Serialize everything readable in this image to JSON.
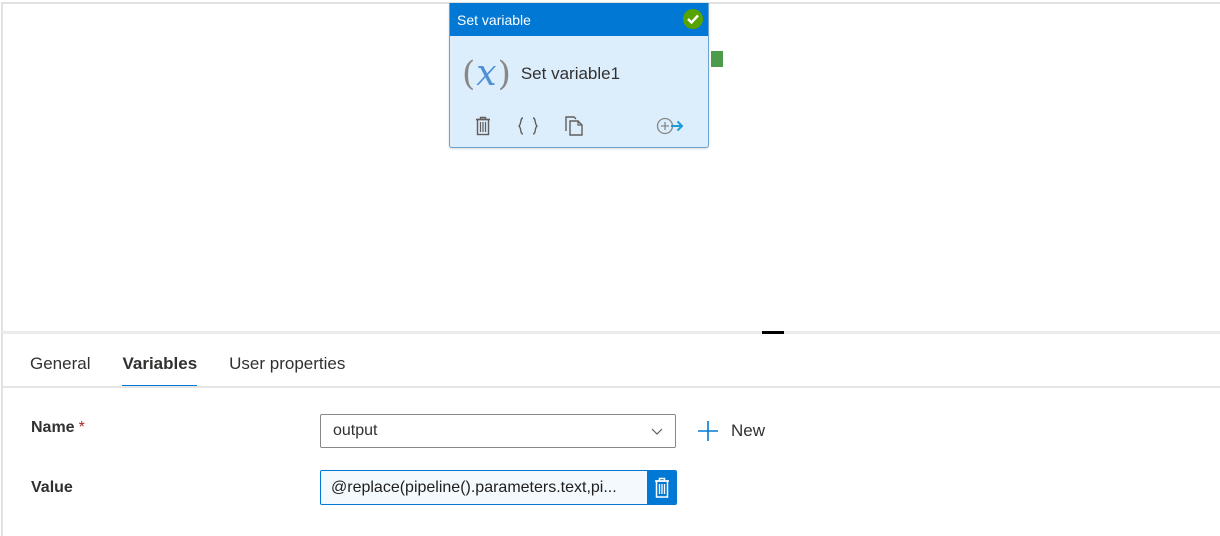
{
  "canvas": {
    "activity": {
      "type_label": "Set variable",
      "name": "Set variable1",
      "status": "succeeded",
      "icon": "variable-x-icon",
      "actions": [
        {
          "name": "delete",
          "icon": "trash-icon"
        },
        {
          "name": "code",
          "icon": "braces-icon"
        },
        {
          "name": "clone",
          "icon": "copy-icon"
        },
        {
          "name": "add-output",
          "icon": "add-output-arrow-icon"
        }
      ]
    },
    "colors": {
      "header": "#0078d4",
      "success": "#57a300",
      "port": "#4c9a4c",
      "node_bg": "#dcedfc"
    }
  },
  "properties": {
    "tabs": [
      {
        "label": "General",
        "active": false
      },
      {
        "label": "Variables",
        "active": true
      },
      {
        "label": "User properties",
        "active": false
      }
    ],
    "fields": {
      "name": {
        "label": "Name",
        "required_marker": "*",
        "value": "output",
        "new_label": "New"
      },
      "value": {
        "label": "Value",
        "value": "@replace(pipeline().parameters.text,pi..."
      }
    }
  }
}
